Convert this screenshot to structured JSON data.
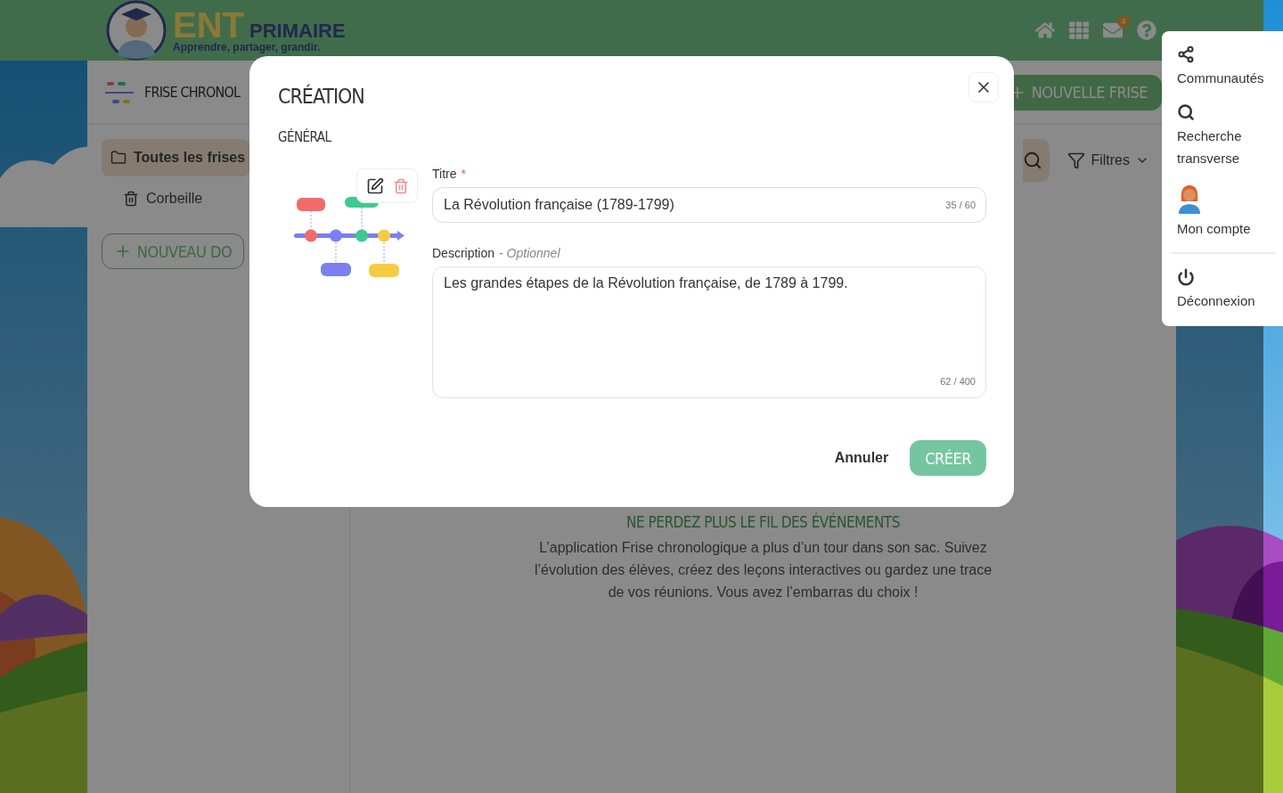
{
  "header": {
    "logo": {
      "letters": "ENT",
      "name": "PRIMAIRE",
      "tagline": "Apprendre, partager, grandir."
    },
    "icons": [
      {
        "kind": "home"
      },
      {
        "kind": "apps"
      },
      {
        "kind": "mail",
        "badge": "4"
      },
      {
        "kind": "help"
      }
    ]
  },
  "app": {
    "title": "FRISE CHRONOL",
    "new_button": "NOUVELLE FRISE",
    "sidebar": {
      "items": [
        {
          "label": "Toutes les frises",
          "kind": "folder",
          "selected": true
        },
        {
          "label": "Corbeille",
          "kind": "trash",
          "selected": false
        }
      ],
      "new_button": "NOUVEAU DO"
    },
    "toolbar": {
      "filters": "Filtres"
    },
    "empty_state": {
      "heading": "NE PERDEZ PLUS LE FIL DES ÉVÉNEMENTS",
      "text": "L’application Frise chronologique a plus d’un tour dans son sac. Suivez l’évolution des élèves, créez des leçons interactives ou gardez une trace de vos réunions. Vous avez l’embarras du choix !"
    }
  },
  "modal": {
    "title": "CRÉATION",
    "section": "GÉNÉRAL",
    "title_field": {
      "label": "Titre",
      "required": "*",
      "value": "La Révolution française (1789-1799)",
      "counter": "35 / 60"
    },
    "description_field": {
      "label": "Description",
      "hint": "- Optionnel",
      "value": "Les grandes étapes de la Révolution française, de 1789 à 1799.",
      "counter": "62 / 400"
    },
    "cancel": "Annuler",
    "submit": "CRÉER"
  },
  "user_menu": {
    "items": [
      {
        "kind": "share",
        "label": "Communautés"
      },
      {
        "kind": "search",
        "label": "Recherche transverse"
      },
      {
        "kind": "avatar",
        "label": "Mon compte"
      },
      {
        "kind": "power",
        "label": "Déconnexion"
      }
    ]
  }
}
